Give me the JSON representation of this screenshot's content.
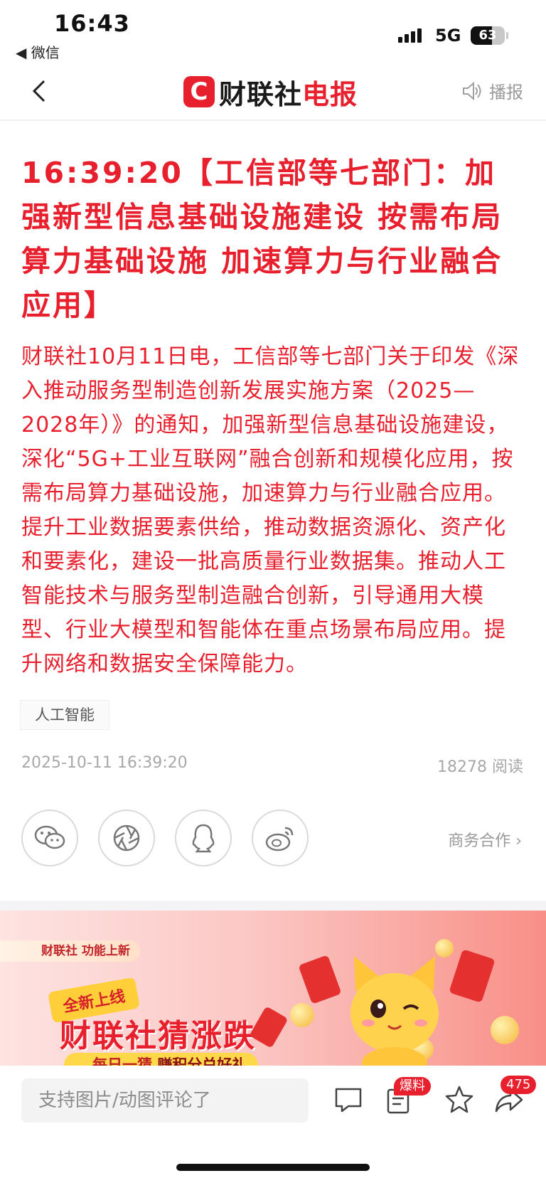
{
  "status_bar": {
    "time": "16:43",
    "back_app": "◀ 微信",
    "network": "5G",
    "battery": "63",
    "battery_level": 0.63
  },
  "nav": {
    "back_icon": "chevron-left-icon",
    "logo_letter": "C",
    "brand_black": "财联社",
    "brand_red": "电报",
    "broadcast_label": "播报"
  },
  "article": {
    "headline": "16:39:20【工信部等七部门：加强新型信息基础设施建设 按需布局算力基础设施 加速算力与行业融合应用】",
    "body": "财联社10月11日电，工信部等七部门关于印发《深入推动服务型制造创新发展实施方案（2025—2028年）》的通知，加强新型信息基础设施建设，深化“5G+工业互联网”融合创新和规模化应用，按需布局算力基础设施，加速算力与行业融合应用。提升工业数据要素供给，推动数据资源化、资产化和要素化，建设一批高质量行业数据集。推动人工智能技术与服务型制造融合创新，引导通用大模型、行业大模型和智能体在重点场景布局应用。提升网络和数据安全保障能力。",
    "tag": "人工智能",
    "published": "2025-10-11 16:39:20",
    "reads": "18278 阅读"
  },
  "share": {
    "icons": [
      "wechat-icon",
      "moments-icon",
      "qq-icon",
      "weibo-icon"
    ],
    "business_link": "商务合作 ›"
  },
  "banner": {
    "top_tag": "财联社 功能上新",
    "new_badge": "全新上线",
    "title": "财联社猜涨跌",
    "slogan_plain": "每日一猜",
    "slogan_bold": "赚积分兑好礼"
  },
  "bottom_bar": {
    "comment_placeholder": "支持图片/动图评论了",
    "scoop_badge": "爆料",
    "share_count": "475"
  },
  "colors": {
    "accent_red": "#e8202e",
    "muted_gray": "#a8a8a8"
  }
}
